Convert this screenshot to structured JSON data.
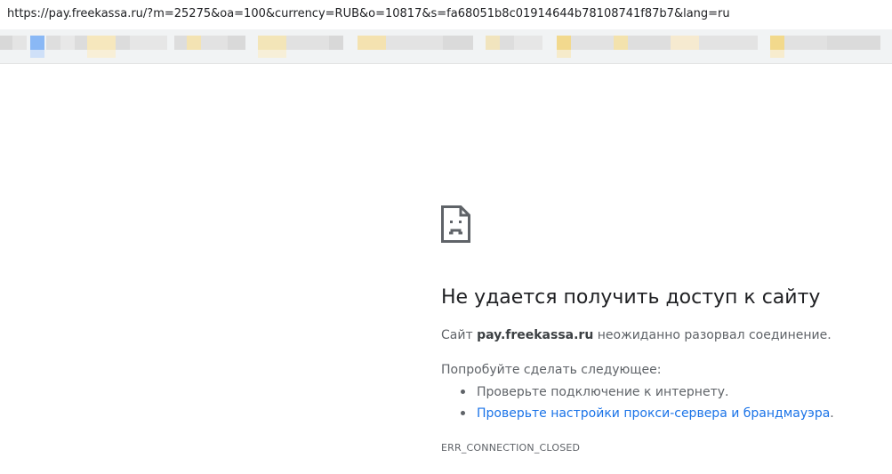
{
  "browser": {
    "url": "https://pay.freekassa.ru/?m=25275&oa=100&currency=RUB&o=10817&s=fa68051b8c01914644b78108741f87b7&lang=ru"
  },
  "error": {
    "icon": "sad-page-icon",
    "title": "Не удается получить доступ к сайту",
    "summary_prefix": "Сайт ",
    "summary_host": "pay.freekassa.ru",
    "summary_suffix": " неожиданно разорвал соединение.",
    "suggestions_heading": "Попробуйте сделать следующее:",
    "suggestions": [
      {
        "text": "Проверьте подключение к интернету."
      },
      {
        "text": "Проверьте настройки прокси-сервера и брандмауэра",
        "tail": "."
      }
    ],
    "error_code": "ERR_CONNECTION_CLOSED"
  },
  "colors": {
    "title": "#202124",
    "body_text": "#5f6368",
    "link": "#1a73e8",
    "bookmarks_bar": "#f1f3f4"
  }
}
